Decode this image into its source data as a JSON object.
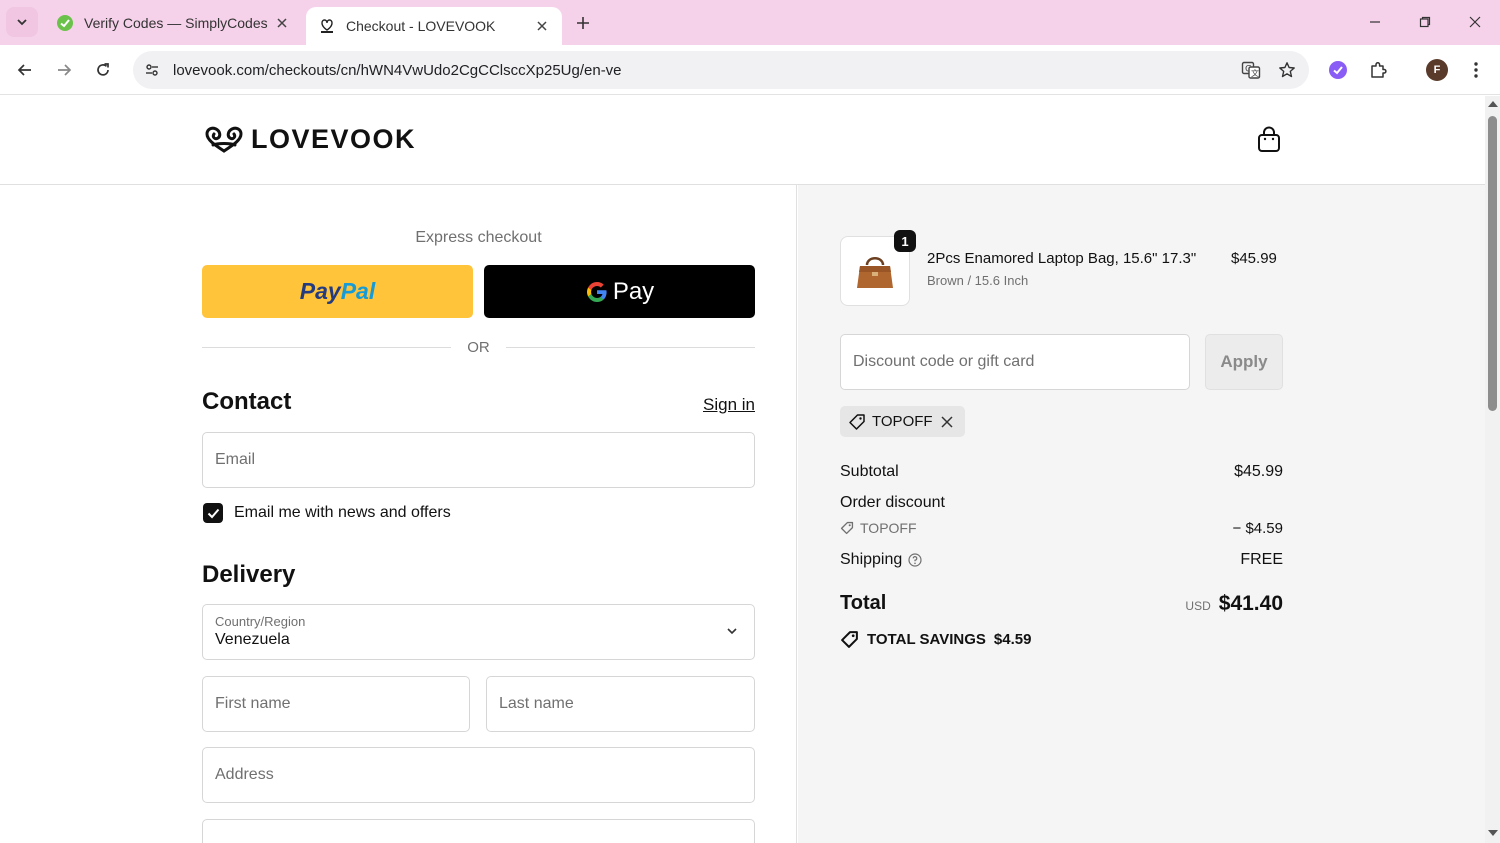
{
  "browser": {
    "tabs": [
      {
        "title": "Verify Codes — SimplyCodes",
        "active": false
      },
      {
        "title": "Checkout - LOVEVOOK",
        "active": true
      }
    ],
    "url": "lovevook.com/checkouts/cn/hWN4VwUdo2CgCClsccXp25Ug/en-ve",
    "profile_initial": "F"
  },
  "header": {
    "logo_text": "LOVEVOOK"
  },
  "checkout": {
    "express_label": "Express checkout",
    "paypal_part1": "Pay",
    "paypal_part2": "Pal",
    "gpay_label": "Pay",
    "or_label": "OR",
    "contact_title": "Contact",
    "sign_in": "Sign in",
    "email_placeholder": "Email",
    "newsletter_label": "Email me with news and offers",
    "newsletter_checked": true,
    "delivery_title": "Delivery",
    "country_label": "Country/Region",
    "country_value": "Venezuela",
    "first_name_placeholder": "First name",
    "last_name_placeholder": "Last name",
    "address_placeholder": "Address"
  },
  "summary": {
    "item": {
      "quantity": "1",
      "name": "2Pcs Enamored Laptop Bag, 15.6\" 17.3\"",
      "variant": "Brown / 15.6 Inch",
      "price": "$45.99"
    },
    "discount_placeholder": "Discount code or gift card",
    "apply_label": "Apply",
    "applied_code": "TOPOFF",
    "subtotal_label": "Subtotal",
    "subtotal_value": "$45.99",
    "order_discount_label": "Order discount",
    "discount_code": "TOPOFF",
    "discount_value": "− $4.59",
    "shipping_label": "Shipping",
    "shipping_value": "FREE",
    "total_label": "Total",
    "total_currency": "USD",
    "total_value": "$41.40",
    "savings_label": "TOTAL SAVINGS",
    "savings_value": "$4.59"
  },
  "colors": {
    "tabbar": "#f6d2ea",
    "paypal": "#ffc43a",
    "gpay": "#000000",
    "summary_bg": "#f5f5f5"
  }
}
